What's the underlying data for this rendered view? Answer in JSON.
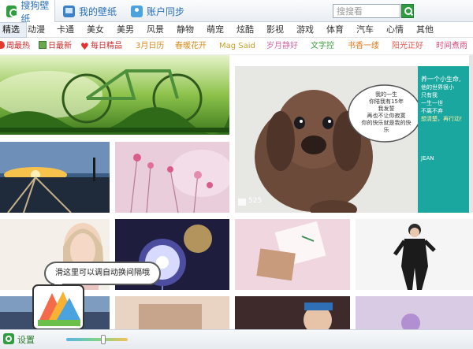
{
  "topbar": {
    "tabs": [
      {
        "label": "搜狗壁纸",
        "icon": "sogou-logo-icon",
        "active": true
      },
      {
        "label": "我的壁纸",
        "icon": "my-wallpaper-icon",
        "active": false
      },
      {
        "label": "账户同步",
        "icon": "account-sync-icon",
        "active": false
      }
    ],
    "search_placeholder": "搜搜看"
  },
  "categories": [
    "精选",
    "动漫",
    "卡通",
    "美女",
    "美男",
    "风景",
    "静物",
    "萌宠",
    "炫酷",
    "影视",
    "游戏",
    "体育",
    "汽车",
    "心情",
    "其他"
  ],
  "tags": [
    {
      "label": "周最热",
      "icon": "hot-icon"
    },
    {
      "label": "日最新",
      "icon": "new-icon"
    },
    {
      "label": "每日精品",
      "icon": "heart-icon"
    },
    {
      "label": "3月日历"
    },
    {
      "label": "春暖花开"
    },
    {
      "label": "Mag Said"
    },
    {
      "label": "岁月静好"
    },
    {
      "label": "文字控"
    },
    {
      "label": "书香一缕"
    },
    {
      "label": "阳光正好"
    },
    {
      "label": "时间煮雨"
    }
  ],
  "tag_colors": [
    "#cc2b2b",
    "#cc2b2b",
    "#cc2b2b",
    "#d98b1f",
    "#d98b1f",
    "#c9a02a",
    "#d36aa8",
    "#3d9a3d",
    "#e07a1f",
    "#e15b4d",
    "#d94c7a"
  ],
  "featured": {
    "quote_lines": [
      "我的一生",
      "你陪我有15年",
      "我发誓",
      "再也不让你寂寞",
      "你的快乐就是我的快乐"
    ],
    "side_title": "养一个小生命,",
    "side_lines": [
      "他的世界很小",
      "只有我",
      "一生一世",
      "不离不弃"
    ],
    "side_highlight": "想清楚，再行动！",
    "brand": "JEAN",
    "badge_count": "525",
    "colors": {
      "teal": "#1aa7a0"
    }
  },
  "scroll_hint": "滑这里可以调自动换间隔哦",
  "bottombar": {
    "settings_label": "设置",
    "interval_level": 0.6
  }
}
